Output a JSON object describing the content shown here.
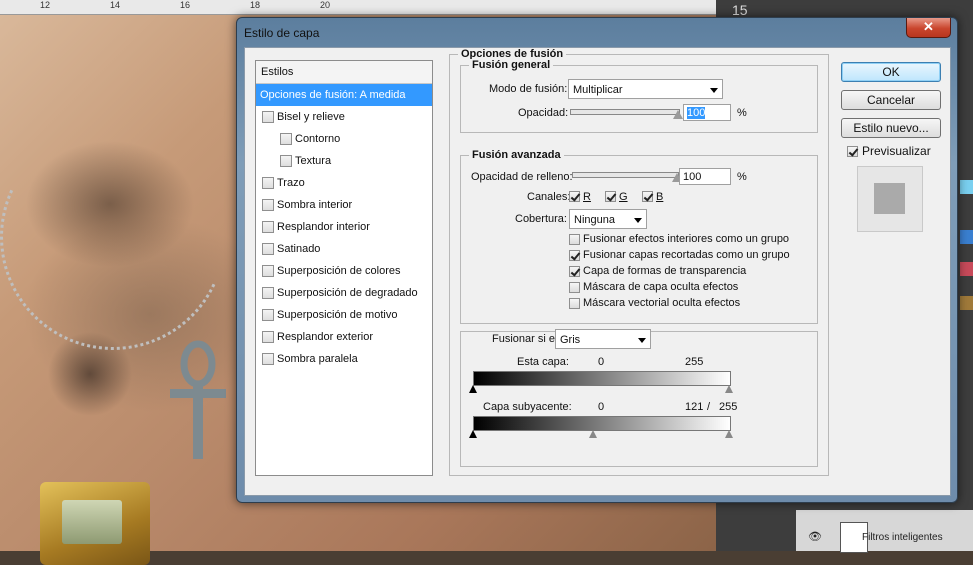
{
  "ruler": {
    "ticks": [
      "12",
      "14",
      "16",
      "18",
      "20"
    ]
  },
  "right_panel": {
    "tab_number": "15",
    "layer_label": "Filtros inteligentes"
  },
  "dialog": {
    "title": "Estilo de capa",
    "close_symbol": "✕"
  },
  "styles": {
    "header": "Estilos",
    "items": [
      {
        "label": "Opciones de fusión: A medida",
        "active": true,
        "checkbox": false
      },
      {
        "label": "Bisel y relieve",
        "checkbox": true
      },
      {
        "label": "Contorno",
        "checkbox": true,
        "indent": true
      },
      {
        "label": "Textura",
        "checkbox": true,
        "indent": true
      },
      {
        "label": "Trazo",
        "checkbox": true
      },
      {
        "label": "Sombra interior",
        "checkbox": true
      },
      {
        "label": "Resplandor interior",
        "checkbox": true
      },
      {
        "label": "Satinado",
        "checkbox": true
      },
      {
        "label": "Superposición de colores",
        "checkbox": true
      },
      {
        "label": "Superposición de degradado",
        "checkbox": true
      },
      {
        "label": "Superposición de motivo",
        "checkbox": true
      },
      {
        "label": "Resplandor exterior",
        "checkbox": true
      },
      {
        "label": "Sombra paralela",
        "checkbox": true
      }
    ]
  },
  "blend": {
    "section_title": "Opciones de fusión",
    "general": {
      "title": "Fusión general",
      "mode_label": "Modo de fusión:",
      "mode_value": "Multiplicar",
      "opacity_label": "Opacidad:",
      "opacity_value": "100",
      "opacity_percent": 100,
      "percent_sign": "%"
    },
    "advanced": {
      "title": "Fusión avanzada",
      "fill_label": "Opacidad de relleno:",
      "fill_value": "100",
      "fill_percent": 100,
      "percent_sign": "%",
      "channels_label": "Canales:",
      "channel_r": "R",
      "channel_g": "G",
      "channel_b": "B",
      "knockout_label": "Cobertura:",
      "knockout_value": "Ninguna",
      "options": [
        {
          "label": "Fusionar efectos interiores como un grupo",
          "checked": false
        },
        {
          "label": "Fusionar capas recortadas como un grupo",
          "checked": true
        },
        {
          "label": "Capa de formas de transparencia",
          "checked": true
        },
        {
          "label": "Máscara de capa oculta efectos",
          "checked": false
        },
        {
          "label": "Máscara vectorial oculta efectos",
          "checked": false
        }
      ]
    },
    "blend_if": {
      "label": "Fusionar si es:",
      "value": "Gris",
      "this_layer_label": "Esta capa:",
      "this_layer_min": "0",
      "this_layer_max": "255",
      "underlying_label": "Capa subyacente:",
      "underlying_min": "0",
      "underlying_split_a": "121",
      "underlying_slash": "/",
      "underlying_split_b": "255"
    }
  },
  "buttons": {
    "ok": "OK",
    "cancel": "Cancelar",
    "new_style": "Estilo nuevo...",
    "preview_label": "Previsualizar",
    "preview_checked": true
  }
}
